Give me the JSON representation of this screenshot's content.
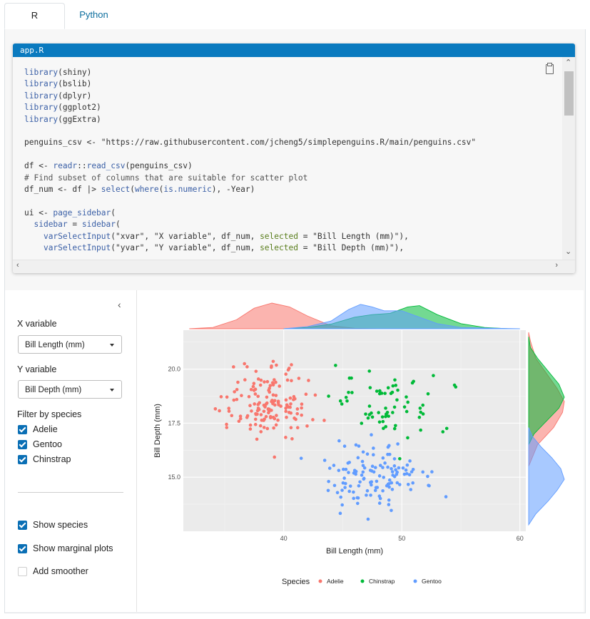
{
  "tabs": {
    "r": "R",
    "python": "Python"
  },
  "editor": {
    "filename": "app.R",
    "lines": [
      "library(shiny)",
      "library(bslib)",
      "library(dplyr)",
      "library(ggplot2)",
      "library(ggExtra)",
      "",
      "penguins_csv <- \"https://raw.githubusercontent.com/jcheng5/simplepenguins.R/main/penguins.csv\"",
      "",
      "df <- readr::read_csv(penguins_csv)",
      "# Find subset of columns that are suitable for scatter plot",
      "df_num <- df |> select(where(is.numeric), -Year)",
      "",
      "ui <- page_sidebar(",
      "  sidebar = sidebar(",
      "    varSelectInput(\"xvar\", \"X variable\", df_num, selected = \"Bill Length (mm)\"),",
      "    varSelectInput(\"yvar\", \"Y variable\", df_num, selected = \"Bill Depth (mm)\"),"
    ]
  },
  "sidebar": {
    "x_label": "X variable",
    "x_value": "Bill Length (mm)",
    "y_label": "Y variable",
    "y_value": "Bill Depth (mm)",
    "filter_label": "Filter by species",
    "species": [
      {
        "label": "Adelie",
        "checked": true
      },
      {
        "label": "Gentoo",
        "checked": true
      },
      {
        "label": "Chinstrap",
        "checked": true
      }
    ],
    "options": [
      {
        "label": "Show species",
        "checked": true
      },
      {
        "label": "Show marginal plots",
        "checked": true
      },
      {
        "label": "Add smoother",
        "checked": false
      }
    ]
  },
  "chart_data": {
    "type": "scatter",
    "xlabel": "Bill Length (mm)",
    "ylabel": "Bill Depth (mm)",
    "xlim": [
      31.5,
      60.5
    ],
    "ylim": [
      12.5,
      21.8
    ],
    "xticks": [
      "40",
      "50",
      "60"
    ],
    "xtick_values": [
      40,
      50,
      60
    ],
    "yticks": [
      "15.0",
      "17.5",
      "20.0"
    ],
    "ytick_values": [
      15.0,
      17.5,
      20.0
    ],
    "legend_title": "Species",
    "legend_position": "bottom",
    "series": [
      {
        "name": "Adelie",
        "color": "#F8766D",
        "center": [
          38.8,
          18.35
        ],
        "spread": [
          2.65,
          1.2
        ],
        "n": 150,
        "marginal_x": [
          [
            32,
            0
          ],
          [
            34,
            0.05
          ],
          [
            36,
            0.35
          ],
          [
            37.5,
            0.8
          ],
          [
            39,
            1
          ],
          [
            40.5,
            0.85
          ],
          [
            42,
            0.5
          ],
          [
            44,
            0.12
          ],
          [
            46,
            0.02
          ],
          [
            48,
            0
          ]
        ],
        "marginal_y": [
          [
            15.5,
            0
          ],
          [
            16.5,
            0.25
          ],
          [
            17.3,
            0.7
          ],
          [
            18.0,
            0.95
          ],
          [
            18.5,
            1
          ],
          [
            19.1,
            0.8
          ],
          [
            19.8,
            0.5
          ],
          [
            20.5,
            0.2
          ],
          [
            21.3,
            0.05
          ],
          [
            21.7,
            0
          ]
        ]
      },
      {
        "name": "Chinstrap",
        "color": "#00BA38",
        "center": [
          48.8,
          18.4
        ],
        "spread": [
          3.3,
          1.1
        ],
        "n": 68,
        "marginal_x": [
          [
            40,
            0
          ],
          [
            42,
            0.05
          ],
          [
            44,
            0.18
          ],
          [
            46,
            0.45
          ],
          [
            47.5,
            0.55
          ],
          [
            49,
            0.6
          ],
          [
            50.5,
            0.85
          ],
          [
            51.5,
            0.9
          ],
          [
            53,
            0.55
          ],
          [
            55,
            0.2
          ],
          [
            57,
            0.05
          ],
          [
            59,
            0
          ]
        ],
        "marginal_y": [
          [
            16.5,
            0
          ],
          [
            17,
            0.15
          ],
          [
            17.6,
            0.5
          ],
          [
            18.2,
            0.85
          ],
          [
            18.7,
            1
          ],
          [
            19.3,
            0.85
          ],
          [
            19.9,
            0.55
          ],
          [
            20.5,
            0.25
          ],
          [
            21,
            0.05
          ],
          [
            21.5,
            0
          ]
        ]
      },
      {
        "name": "Gentoo",
        "color": "#619CFF",
        "center": [
          47.5,
          15.0
        ],
        "spread": [
          3.1,
          0.98
        ],
        "n": 124,
        "marginal_x": [
          [
            40,
            0
          ],
          [
            42,
            0.08
          ],
          [
            44,
            0.3
          ],
          [
            45.5,
            0.75
          ],
          [
            46.5,
            0.95
          ],
          [
            47.5,
            0.85
          ],
          [
            48.5,
            0.7
          ],
          [
            50,
            0.7
          ],
          [
            51.5,
            0.45
          ],
          [
            53,
            0.2
          ],
          [
            55,
            0.05
          ],
          [
            58,
            0.02
          ],
          [
            60,
            0
          ]
        ],
        "marginal_y": [
          [
            12.8,
            0
          ],
          [
            13.3,
            0.2
          ],
          [
            13.9,
            0.55
          ],
          [
            14.4,
            0.8
          ],
          [
            14.9,
            1
          ],
          [
            15.4,
            0.9
          ],
          [
            15.9,
            0.65
          ],
          [
            16.4,
            0.35
          ],
          [
            16.9,
            0.1
          ],
          [
            17.3,
            0
          ]
        ]
      }
    ]
  }
}
